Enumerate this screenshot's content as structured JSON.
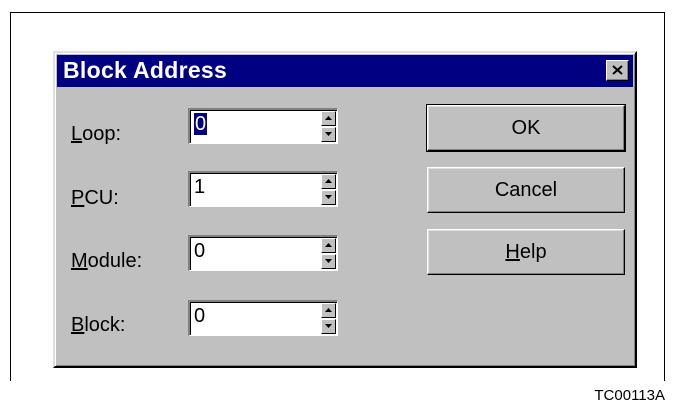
{
  "dialog": {
    "title": "Block Address",
    "fields": [
      {
        "label_first": "L",
        "label_rest": "oop:",
        "value": "0",
        "selected": true
      },
      {
        "label_first": "P",
        "label_rest": "CU:",
        "value": "1",
        "selected": false
      },
      {
        "label_first": "M",
        "label_rest": "odule:",
        "value": "0",
        "selected": false
      },
      {
        "label_first": "B",
        "label_rest": "lock:",
        "value": "0",
        "selected": false
      }
    ],
    "buttons": {
      "ok": "OK",
      "cancel": "Cancel",
      "help_first": "H",
      "help_rest": "elp"
    }
  },
  "caption": "TC00113A",
  "colors": {
    "titlebar": "#000080",
    "face": "#c0c0c0",
    "selection": "#000080"
  },
  "icons": {
    "close": "close-icon",
    "spin_up": "up-arrow-icon",
    "spin_down": "down-arrow-icon"
  }
}
